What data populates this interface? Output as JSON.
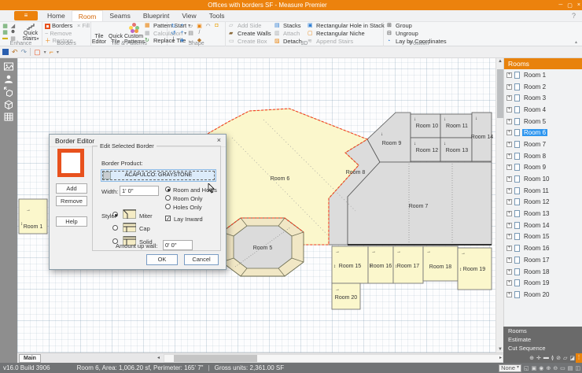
{
  "window": {
    "title": "Offices with borders SF - Measure Premier",
    "minimize": "─",
    "maximize": "▢",
    "close": "×"
  },
  "ribbon": {
    "menu_icon": "≡",
    "tabs": [
      "Home",
      "Room",
      "Seams",
      "Blueprint",
      "View",
      "Tools"
    ],
    "active_tab": "Room",
    "help": "?",
    "collapse": "▴",
    "enhance": {
      "label": "Enhance",
      "quick_stairs": "Quick Stairs"
    },
    "borders": {
      "label": "Borders",
      "borders": "Borders",
      "fill": "Fill",
      "remove": "Remove",
      "restore": "Restore"
    },
    "tile": {
      "label": "Tile & Patterns",
      "tile_editor": "Tile Editor",
      "quick_tile": "Quick Tile",
      "custom_patterns": "Custom Patterns",
      "pattern_start": "Pattern Start",
      "calculation": "Calculation",
      "replace_tile": "Replace Tile"
    },
    "shape": {
      "label": "Shape",
      "row1": [
        {
          "name": "rotate-cw-icon",
          "glyph": "↻",
          "color": "#2B7CD3"
        },
        {
          "name": "move-icon",
          "glyph": "+",
          "color": "#2B7CD3"
        },
        {
          "name": "copy-icon",
          "glyph": "▱",
          "color": "#777777"
        },
        {
          "name": "fill-bucket-icon",
          "glyph": "▣",
          "color": "#E8820C"
        },
        {
          "name": "arc-icon",
          "glyph": "◠",
          "color": "#777777"
        },
        {
          "name": "lock-icon",
          "glyph": "◘",
          "color": "#E8A20C"
        }
      ],
      "row2": [
        {
          "name": "rotate-ccw-icon",
          "glyph": "↺",
          "color": "#2B7CD3"
        },
        {
          "name": "move-alt-icon",
          "glyph": "+",
          "color": "#2B7CD3"
        },
        {
          "name": "grid-icon",
          "glyph": "▤",
          "color": "#777777"
        },
        {
          "name": "line-icon",
          "glyph": "/",
          "color": "#777777"
        }
      ],
      "row3": [
        {
          "name": "split-icon",
          "glyph": "|",
          "color": "#555555"
        },
        {
          "name": "diamond-icon",
          "glyph": "◈",
          "color": "#2B7CD3"
        },
        {
          "name": "curve-icon",
          "glyph": "◡",
          "color": "#777777"
        },
        {
          "name": "point-icon",
          "glyph": "◆",
          "color": "#B8762B"
        }
      ]
    },
    "threed": {
      "label": "3D",
      "add_side": "Add Side",
      "create_walls": "Create Walls",
      "create_box": "Create Box",
      "stacks": "Stacks",
      "attach": "Attach",
      "detach": "Detach",
      "rect_hole": "Rectangular Hole in Stack",
      "rect_niche": "Rectangular Niche",
      "append_stairs": "Append Stairs"
    },
    "position": {
      "label": "Position",
      "group": "Group",
      "ungroup": "Ungroup",
      "lay_by_coordinates": "Lay by Coordinates"
    }
  },
  "quickbar": {
    "undo": "↶",
    "redo": "↷",
    "rect": "▢",
    "corner": "⌐",
    "carat": "▾"
  },
  "dialog": {
    "title": "Border Editor",
    "close": "×",
    "add": "Add",
    "remove": "Remove",
    "help": "Help",
    "groupbox": "Edit Selected Border",
    "product_label": "Border Product:",
    "product": "ACAPULCO: GRAYSTONE",
    "width_label": "Width:",
    "width_value": "1' 0\"",
    "style_label": "Style:",
    "styles": [
      "Miter",
      "Cap",
      "Solid"
    ],
    "selected_style": 0,
    "scope": [
      "Room and Holes",
      "Room Only",
      "Holes Only"
    ],
    "selected_scope": 0,
    "lay_inward": "Lay Inward",
    "lay_inward_checked": "✓",
    "amount_label": "Amount up wall:",
    "amount_value": "0' 0\"",
    "ok": "OK",
    "cancel": "Cancel"
  },
  "rooms_panel": {
    "title": "Rooms",
    "selected_index": 5,
    "items": [
      "Room 1",
      "Room 2",
      "Room 3",
      "Room 4",
      "Room 5",
      "Room 6",
      "Room 7",
      "Room 8",
      "Room 9",
      "Room 10",
      "Room 11",
      "Room 12",
      "Room 13",
      "Room 14",
      "Room 15",
      "Room 16",
      "Room 17",
      "Room 18",
      "Room 19",
      "Room 20"
    ]
  },
  "views_panel": {
    "items": [
      "Rooms",
      "Estimate",
      "Cut Sequence"
    ],
    "icons": [
      {
        "name": "zoom-tool-icon",
        "glyph": "⊕"
      },
      {
        "name": "settings-icon",
        "glyph": "✛"
      },
      {
        "name": "layers-icon",
        "glyph": "▬"
      },
      {
        "name": "pin-icon",
        "glyph": "≬"
      },
      {
        "name": "no-icon",
        "glyph": "⊘"
      },
      {
        "name": "pages-icon",
        "glyph": "▱"
      },
      {
        "name": "panel-icon",
        "glyph": "◪"
      }
    ],
    "more": "⋮"
  },
  "plan": {
    "r1": "Room 1",
    "r5": "Room 5",
    "r6": "Room 6",
    "r7": "Room 7",
    "r8": "Room 8",
    "r9": "Room 9",
    "r10": "Room 10",
    "r11": "Room 11",
    "r12": "Room 12",
    "r13": "Room 13",
    "r14": "Room 14",
    "r15": "Room 15",
    "r16": "Room 16",
    "r17": "Room 17",
    "r18": "Room 18",
    "r19": "Room 19",
    "r20": "Room 20"
  },
  "bottom": {
    "tab": "Main"
  },
  "status_bar": {
    "version": "v16.0 Build 3906",
    "room_info": "Room 6, Area: 1,006.20 sf, Perimeter: 165' 7\"",
    "divider": "|",
    "gross": "Gross units: 2,361.00 SF",
    "layer": "None",
    "icons": [
      {
        "name": "select-icon",
        "glyph": "◱"
      },
      {
        "name": "pan-icon",
        "glyph": "▣"
      },
      {
        "name": "orbit-icon",
        "glyph": "◉"
      },
      {
        "name": "zoom-in-icon",
        "glyph": "⊕"
      },
      {
        "name": "zoom-out-icon",
        "glyph": "⊖"
      },
      {
        "name": "zoom-window-icon",
        "glyph": "▭"
      },
      {
        "name": "zoom-extents-icon",
        "glyph": "▤"
      },
      {
        "name": "view-icon",
        "glyph": "◫"
      }
    ]
  },
  "colors": {
    "accent_orange": "#EC820D",
    "selection_blue": "#2E96EF",
    "border_red": "#E8511D",
    "room_yellow": "#FBF7CC",
    "room_gray": "#DCDCDC"
  }
}
